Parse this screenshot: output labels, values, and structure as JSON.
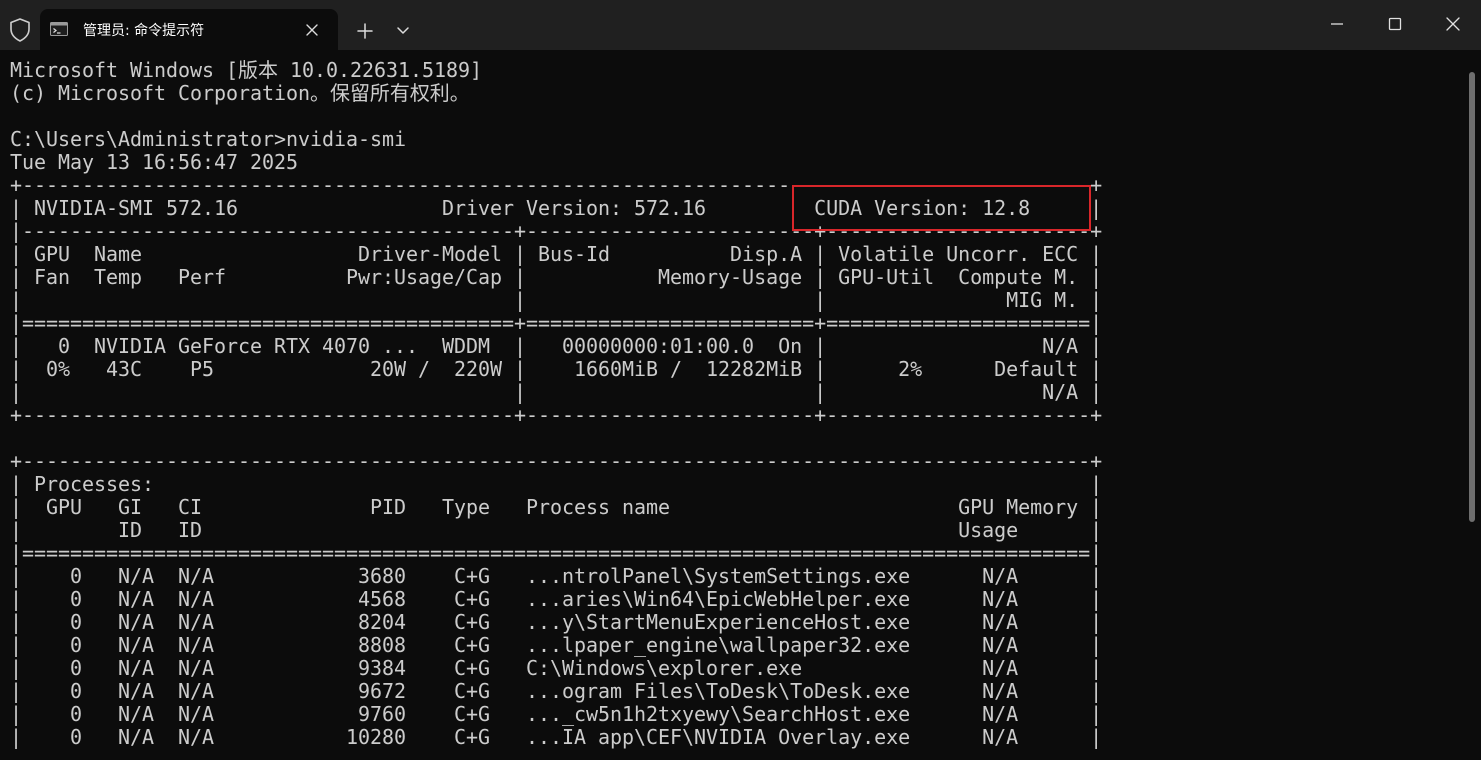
{
  "window": {
    "tab_title": "管理员: 命令提示符"
  },
  "icons": {
    "shield": "shield-icon",
    "terminal": "terminal-icon",
    "tab_close": "close-icon",
    "new_tab": "plus-icon",
    "dropdown": "chevron-down-icon",
    "minimize": "minimize-icon",
    "maximize": "maximize-icon",
    "close": "close-icon"
  },
  "colors": {
    "background": "#0c0c0c",
    "titlebar": "#202020",
    "text": "#cccccc",
    "highlight": "#d9262a"
  },
  "terminal": {
    "lines": [
      "Microsoft Windows [版本 10.0.22631.5189]",
      "(c) Microsoft Corporation。保留所有权利。",
      "",
      "C:\\Users\\Administrator>nvidia-smi",
      "Tue May 13 16:56:47 2025",
      "+-----------------------------------------------------------------------------------------+",
      "| NVIDIA-SMI 572.16                 Driver Version: 572.16         CUDA Version: 12.8     |",
      "|-----------------------------------------+------------------------+----------------------+",
      "| GPU  Name                  Driver-Model | Bus-Id          Disp.A | Volatile Uncorr. ECC |",
      "| Fan  Temp   Perf          Pwr:Usage/Cap |           Memory-Usage | GPU-Util  Compute M. |",
      "|                                         |                        |               MIG M. |",
      "|=========================================+========================+======================|",
      "|   0  NVIDIA GeForce RTX 4070 ...  WDDM  |   00000000:01:00.0  On |                  N/A |",
      "|  0%   43C    P5             20W /  220W |    1660MiB /  12282MiB |      2%      Default |",
      "|                                         |                        |                  N/A |",
      "+-----------------------------------------+------------------------+----------------------+",
      "",
      "+-----------------------------------------------------------------------------------------+",
      "| Processes:                                                                              |",
      "|  GPU   GI   CI              PID   Type   Process name                        GPU Memory |",
      "|        ID   ID                                                               Usage      |",
      "|=========================================================================================|",
      "|    0   N/A  N/A            3680    C+G   ...ntrolPanel\\SystemSettings.exe      N/A      |",
      "|    0   N/A  N/A            4568    C+G   ...aries\\Win64\\EpicWebHelper.exe      N/A      |",
      "|    0   N/A  N/A            8204    C+G   ...y\\StartMenuExperienceHost.exe      N/A      |",
      "|    0   N/A  N/A            8808    C+G   ...lpaper_engine\\wallpaper32.exe      N/A      |",
      "|    0   N/A  N/A            9384    C+G   C:\\Windows\\explorer.exe               N/A      |",
      "|    0   N/A  N/A            9672    C+G   ...ogram Files\\ToDesk\\ToDesk.exe      N/A      |",
      "|    0   N/A  N/A            9760    C+G   ..._cw5n1h2txyewy\\SearchHost.exe      N/A      |",
      "|    0   N/A  N/A           10280    C+G   ...IA app\\CEF\\NVIDIA Overlay.exe      N/A      |"
    ]
  }
}
